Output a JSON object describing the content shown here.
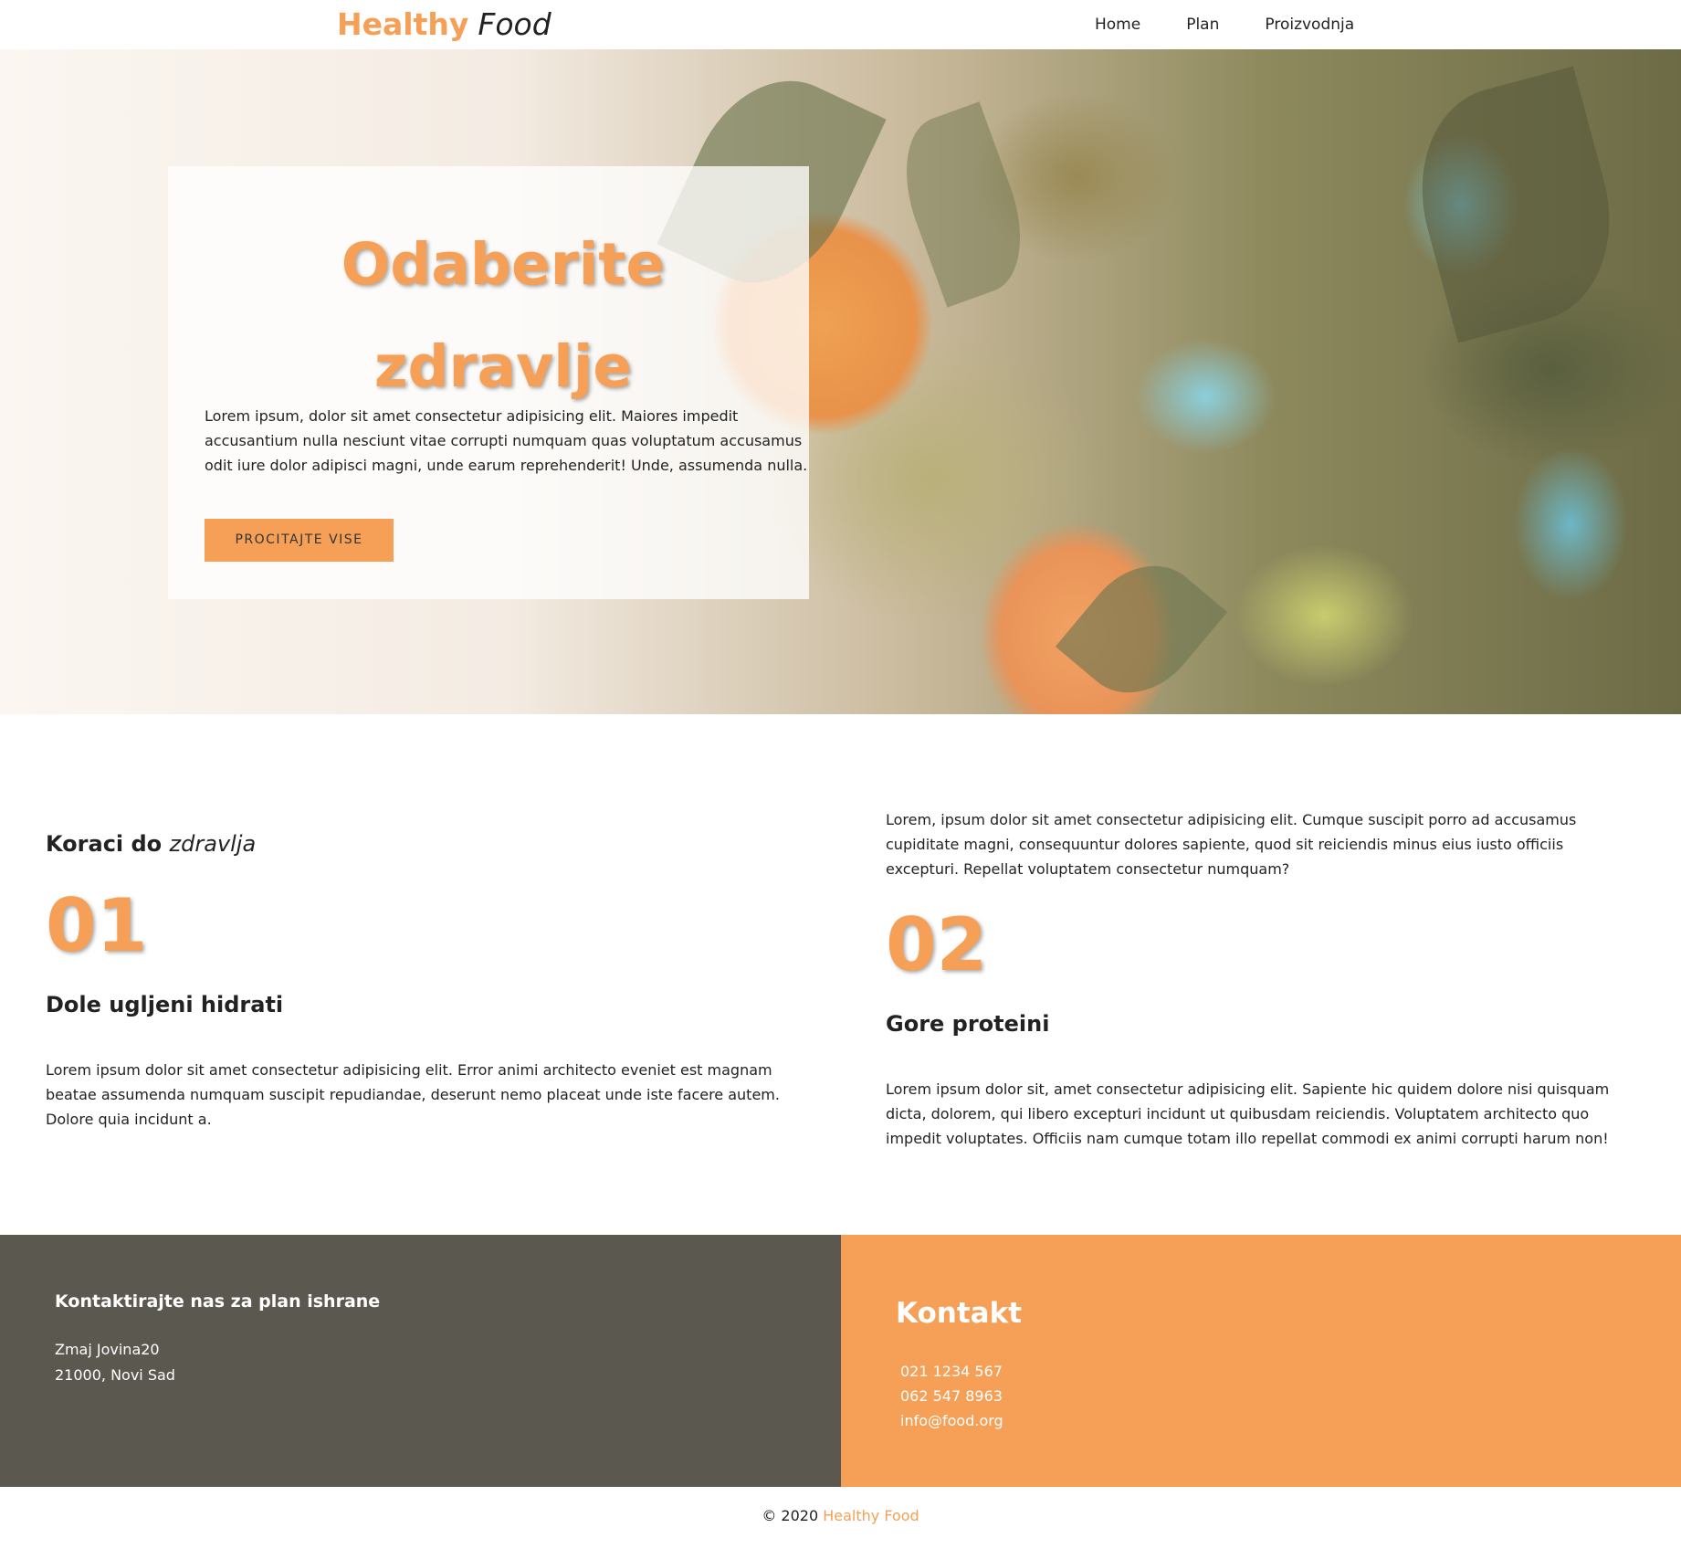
{
  "brand": {
    "part1": "Healthy",
    "part2": "Food"
  },
  "nav": {
    "items": [
      "Home",
      "Plan",
      "Proizvodnja"
    ]
  },
  "hero": {
    "title_line1": "Odaberite",
    "title_line2": "zdravlje",
    "text": "Lorem ipsum, dolor sit amet consectetur adipisicing elit. Maiores impedit accusantium nulla nesciunt vitae corrupti numquam quas voluptatum accusamus odit iure dolor adipisci magni, unde earum reprehenderit! Unde, assumenda nulla.",
    "button": "PROCITAJTE VISE"
  },
  "steps": {
    "heading_bold": "Koraci do",
    "heading_italic": "zdravlja",
    "intro": "Lorem, ipsum dolor sit amet consectetur adipisicing elit. Cumque suscipit porro ad accusamus cupiditate magni, consequuntur dolores sapiente, quod sit reiciendis minus eius iusto officiis excepturi. Repellat voluptatem consectetur numquam?",
    "items": [
      {
        "number": "01",
        "title": "Dole ugljeni hidrati",
        "text": "Lorem ipsum dolor sit amet consectetur adipisicing elit. Error animi architecto eveniet est magnam beatae assumenda numquam suscipit repudiandae, deserunt nemo placeat unde iste facere autem. Dolore quia incidunt a."
      },
      {
        "number": "02",
        "title": "Gore proteini",
        "text": "Lorem ipsum dolor sit, amet consectetur adipisicing elit. Sapiente hic quidem dolore nisi quisquam dicta, dolorem, qui libero excepturi incidunt ut quibusdam reiciendis. Voluptatem architecto quo impedit voluptates. Officiis nam cumque totam illo repellat commodi ex animi corrupti harum non!"
      }
    ]
  },
  "footer": {
    "left_title": "Kontaktirajte nas za plan ishrane",
    "address_line1": "Zmaj Jovina20",
    "address_line2": "21000, Novi Sad",
    "right_title": "Kontakt",
    "phone1": "021 1234 567",
    "phone2": "062 547 8963",
    "email": "info@food.org"
  },
  "copyright": {
    "prefix": "© 2020",
    "brand": "Healthy Food"
  },
  "colors": {
    "accent": "#f5a056",
    "dark": "#5b5850",
    "text": "#222222"
  }
}
